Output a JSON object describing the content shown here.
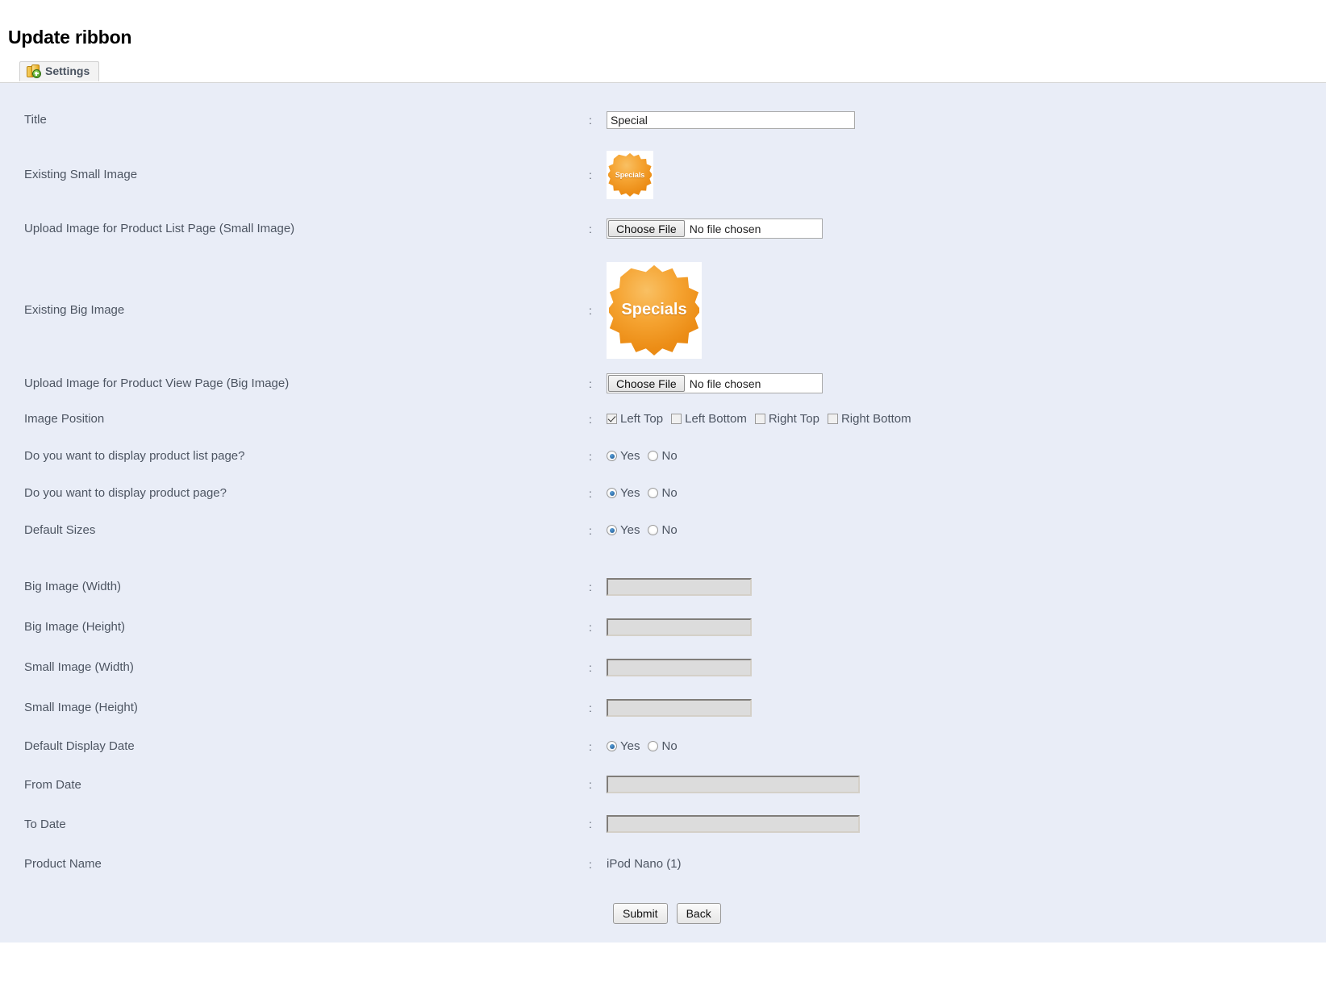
{
  "page": {
    "title": "Update ribbon"
  },
  "tab": {
    "label": "Settings",
    "icon": "coins-plus-icon"
  },
  "separator": ":",
  "form": {
    "rows": {
      "title": {
        "label": "Title",
        "value": "Special",
        "placeholder": ""
      },
      "existing_small_image": {
        "label": "Existing Small Image",
        "image_alt": "Specials",
        "badge_text": "Specials"
      },
      "upload_small": {
        "label": "Upload Image for Product List Page (Small Image)",
        "button_label": "Choose File",
        "file_status": "No file chosen"
      },
      "existing_big_image": {
        "label": "Existing Big Image",
        "image_alt": "Specials",
        "badge_text": "Specials"
      },
      "upload_big": {
        "label": "Upload Image for Product View Page (Big Image)",
        "button_label": "Choose File",
        "file_status": "No file chosen"
      },
      "image_position": {
        "label": "Image Position",
        "options": [
          {
            "label": "Left Top",
            "checked": true
          },
          {
            "label": "Left Bottom",
            "checked": false
          },
          {
            "label": "Right Top",
            "checked": false
          },
          {
            "label": "Right Bottom",
            "checked": false
          }
        ]
      },
      "display_product_list_page": {
        "label": "Do you want to display product list page?",
        "options": [
          {
            "label": "Yes",
            "selected": true
          },
          {
            "label": "No",
            "selected": false
          }
        ]
      },
      "display_product_page": {
        "label": "Do you want to display product page?",
        "options": [
          {
            "label": "Yes",
            "selected": true
          },
          {
            "label": "No",
            "selected": false
          }
        ]
      },
      "default_sizes": {
        "label": "Default Sizes",
        "options": [
          {
            "label": "Yes",
            "selected": true
          },
          {
            "label": "No",
            "selected": false
          }
        ]
      },
      "big_image_width": {
        "label": "Big Image (Width)",
        "value": "",
        "disabled": true
      },
      "big_image_height": {
        "label": "Big Image (Height)",
        "value": "",
        "disabled": true
      },
      "small_image_width": {
        "label": "Small Image (Width)",
        "value": "",
        "disabled": true
      },
      "small_image_height": {
        "label": "Small Image (Height)",
        "value": "",
        "disabled": true
      },
      "default_display_date": {
        "label": "Default Display Date",
        "options": [
          {
            "label": "Yes",
            "selected": true
          },
          {
            "label": "No",
            "selected": false
          }
        ]
      },
      "from_date": {
        "label": "From Date",
        "value": "",
        "disabled": true
      },
      "to_date": {
        "label": "To Date",
        "value": "",
        "disabled": true
      },
      "product_name": {
        "label": "Product Name",
        "value": "iPod Nano (1)"
      }
    },
    "actions": {
      "submit_label": "Submit",
      "back_label": "Back"
    }
  },
  "colors": {
    "panel_bg": "#e9edf7",
    "badge_orange": "#ee9220",
    "label_text": "#4d5562",
    "tab_text": "#4a5360"
  }
}
